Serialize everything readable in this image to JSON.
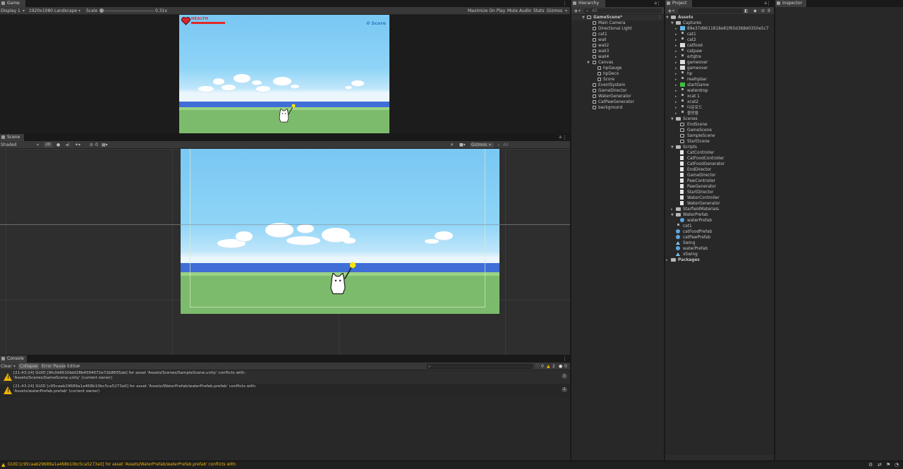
{
  "game": {
    "tab": "Game",
    "display": "Display 1",
    "resolution": "1920x1080 Landscape",
    "scale_label": "Scale",
    "scale_value": "0.31x",
    "maximize": "Maximize On Play",
    "mute": "Mute Audio",
    "stats": "Stats",
    "gizmos": "Gizmos",
    "hud_health": "HEALTH",
    "hud_score": "0 Score"
  },
  "scene": {
    "tab": "Scene",
    "shading": "Shaded",
    "mode2d": "2D",
    "hidden_count": "0",
    "gizmos": "Gizmos",
    "search_placeholder": "All"
  },
  "console": {
    "tab": "Console",
    "clear": "Clear",
    "collapse": "Collapse",
    "error_pause": "Error Pause",
    "editor": "Editor",
    "info_count": "0",
    "warn_count": "2",
    "error_count": "0",
    "messages": [
      {
        "line1": "[21:43:24] GUID [9fc0d4010bbf28b4594072e72b8655ab] for asset 'Assets/Scenes/SampleScene.unity' conflicts with:",
        "line2": "'Assets/Scenes/GameScene.unity' (current owner)",
        "count": "1"
      },
      {
        "line1": "[21:43:24] GUID [c95caab29689a1a468b10bc5ca5273a0] for asset 'Assets/WaterPrefab/waterPrefab.prefab' conflicts with:",
        "line2": "'Assets/waterPrefab.prefab' (current owner)",
        "count": "1"
      }
    ]
  },
  "status_bar": {
    "message": "GUID [c95caab29689a1a468b10bc5ca5273a0] for asset 'Assets/WaterPrefab/waterPrefab.prefab' conflicts with:"
  },
  "hierarchy": {
    "tab": "Hierarchy",
    "search_placeholder": "All",
    "scene": "GameScene*",
    "items": [
      "Main Camera",
      "Directional Light",
      "cat1",
      "wall",
      "wall2",
      "wall3",
      "wall4",
      "Canvas"
    ],
    "canvas_children": [
      "hpGauge",
      "hpDeco",
      "Score"
    ],
    "items_after": [
      "EventSystem",
      "GameDirector",
      "WaterGenerator",
      "CatPawGenerator",
      "background"
    ]
  },
  "project": {
    "tab": "Project",
    "hidden_count": "9",
    "assets": "Assets",
    "captures": "Captures",
    "capture_items": [
      "89e37d9611818e81f65d368d0350e5c7",
      "cat1",
      "cat2",
      "catfood",
      "catpaw",
      "ertgtre",
      "gameover",
      "gameover",
      "hp",
      "realhpbar",
      "startGame",
      "waterdrop",
      "xcat 1",
      "xcat2",
      "다운로드",
      "물방울"
    ],
    "scenes": "Scenes",
    "scene_items": [
      "EndScene",
      "GameScene",
      "SampleScene",
      "StartScene"
    ],
    "scripts": "Scripts",
    "script_items": [
      "CatController",
      "CatFoodController",
      "CatFoodGenerator",
      "EndDirector",
      "GameDirector",
      "PawController",
      "PawGenerator",
      "StartDirector",
      "WaterController",
      "WaterGenerator"
    ],
    "starfield": "StarfieldMaterials",
    "waterprefab_folder": "WaterPrefab",
    "waterprefab_item": "waterPrefab",
    "root_items": [
      "cat1",
      "catFoodPrefab",
      "catPawPrefab",
      "Swing",
      "waterPrefab",
      "xSwing"
    ],
    "packages": "Packages"
  },
  "inspector": {
    "tab": "Inspector"
  },
  "colors": {
    "accent_warning": "#f0b400",
    "sky": "#79c7f3",
    "grass": "#7dbb6c",
    "water": "#3f6fd6"
  }
}
